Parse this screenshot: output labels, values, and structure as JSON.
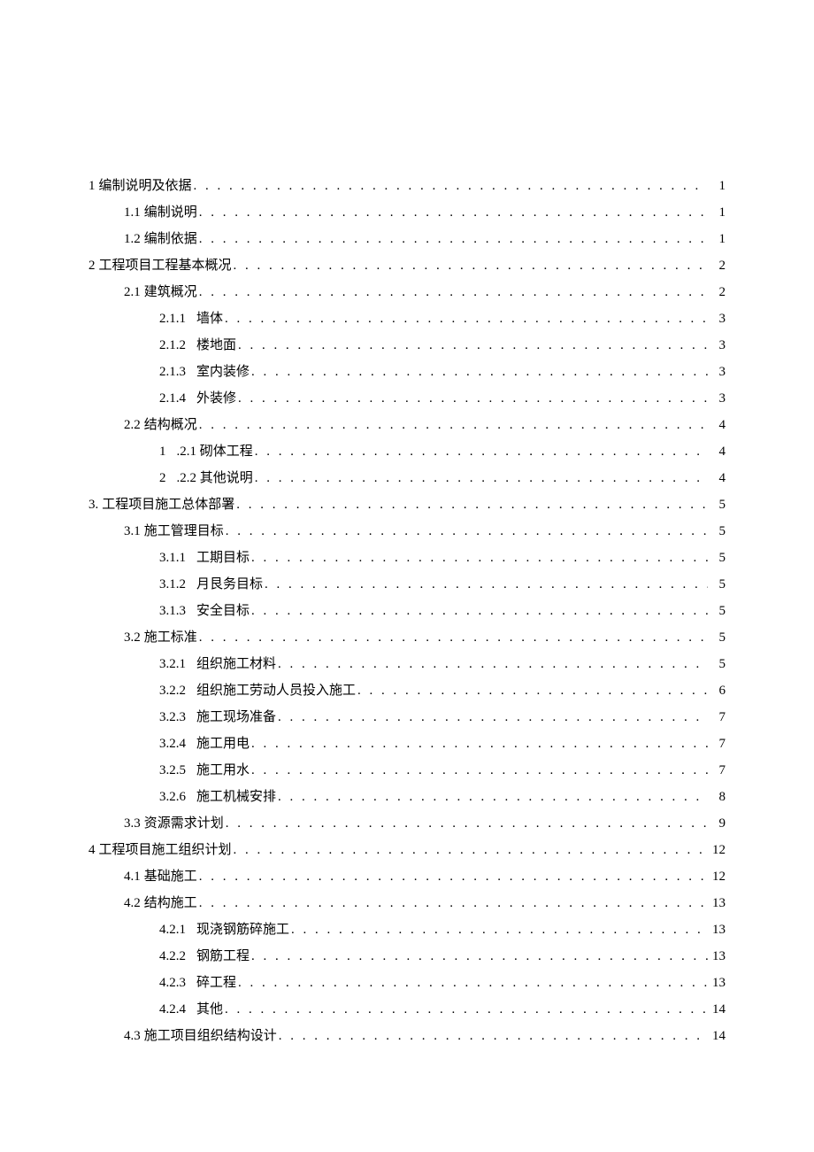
{
  "toc": [
    {
      "level": 0,
      "num": "1",
      "title": "编制说明及依据",
      "page": "1"
    },
    {
      "level": 1,
      "num": "1.1",
      "title": "编制说明",
      "page": "1"
    },
    {
      "level": 1,
      "num": "1.2",
      "title": "编制依据",
      "page": "1"
    },
    {
      "level": 0,
      "num": "2",
      "title": "工程项目工程基本概况",
      "page": "2"
    },
    {
      "level": 1,
      "num": "2.1",
      "title": "建筑概况",
      "page": "2"
    },
    {
      "level": 2,
      "num": "2.1.1",
      "title": "墙体",
      "page": "3"
    },
    {
      "level": 2,
      "num": "2.1.2",
      "title": "楼地面",
      "page": "3"
    },
    {
      "level": 2,
      "num": "2.1.3",
      "title": "室内装修",
      "page": "3"
    },
    {
      "level": 2,
      "num": "2.1.4",
      "title": "外装修",
      "page": "3"
    },
    {
      "level": 1,
      "num": "2.2",
      "title": "结构概况",
      "page": "4"
    },
    {
      "level": 2,
      "num": "1",
      "title": ".2.1 砌体工程",
      "page": "4"
    },
    {
      "level": 2,
      "num": "2",
      "title": ".2.2 其他说明",
      "page": "4"
    },
    {
      "level": 0,
      "num": "3.",
      "title": "工程项目施工总体部署",
      "page": "5"
    },
    {
      "level": 1,
      "num": "3.1",
      "title": "施工管理目标",
      "page": "5"
    },
    {
      "level": 2,
      "num": "3.1.1",
      "title": "工期目标",
      "page": "5"
    },
    {
      "level": 2,
      "num": "3.1.2",
      "title": "月艮务目标",
      "page": "5"
    },
    {
      "level": 2,
      "num": "3.1.3",
      "title": "安全目标",
      "page": "5"
    },
    {
      "level": 1,
      "num": "3.2",
      "title": "施工标准",
      "page": "5"
    },
    {
      "level": 2,
      "num": "3.2.1",
      "title": "组织施工材料",
      "page": "5"
    },
    {
      "level": 2,
      "num": "3.2.2",
      "title": "组织施工劳动人员投入施工",
      "page": "6"
    },
    {
      "level": 2,
      "num": "3.2.3",
      "title": "施工现场准备",
      "page": "7"
    },
    {
      "level": 2,
      "num": "3.2.4",
      "title": "施工用电",
      "page": "7"
    },
    {
      "level": 2,
      "num": "3.2.5",
      "title": "施工用水",
      "page": "7"
    },
    {
      "level": 2,
      "num": "3.2.6",
      "title": "施工机械安排",
      "page": "8"
    },
    {
      "level": 1,
      "num": "3.3",
      "title": "资源需求计划",
      "page": "9"
    },
    {
      "level": 0,
      "num": "4",
      "title": "工程项目施工组织计划",
      "page": "12"
    },
    {
      "level": 1,
      "num": "4.1",
      "title": "基础施工",
      "page": "12"
    },
    {
      "level": 1,
      "num": "4.2",
      "title": "结构施工",
      "page": "13"
    },
    {
      "level": 2,
      "num": "4.2.1",
      "title": "现浇钢筋碎施工",
      "page": "13"
    },
    {
      "level": 2,
      "num": "4.2.2",
      "title": "钢筋工程",
      "page": "13"
    },
    {
      "level": 2,
      "num": "4.2.3",
      "title": "碎工程",
      "page": "13"
    },
    {
      "level": 2,
      "num": "4.2.4",
      "title": "其他",
      "page": "14"
    },
    {
      "level": 1,
      "num": "4.3",
      "title": "施工项目组织结构设计",
      "page": "14"
    }
  ]
}
